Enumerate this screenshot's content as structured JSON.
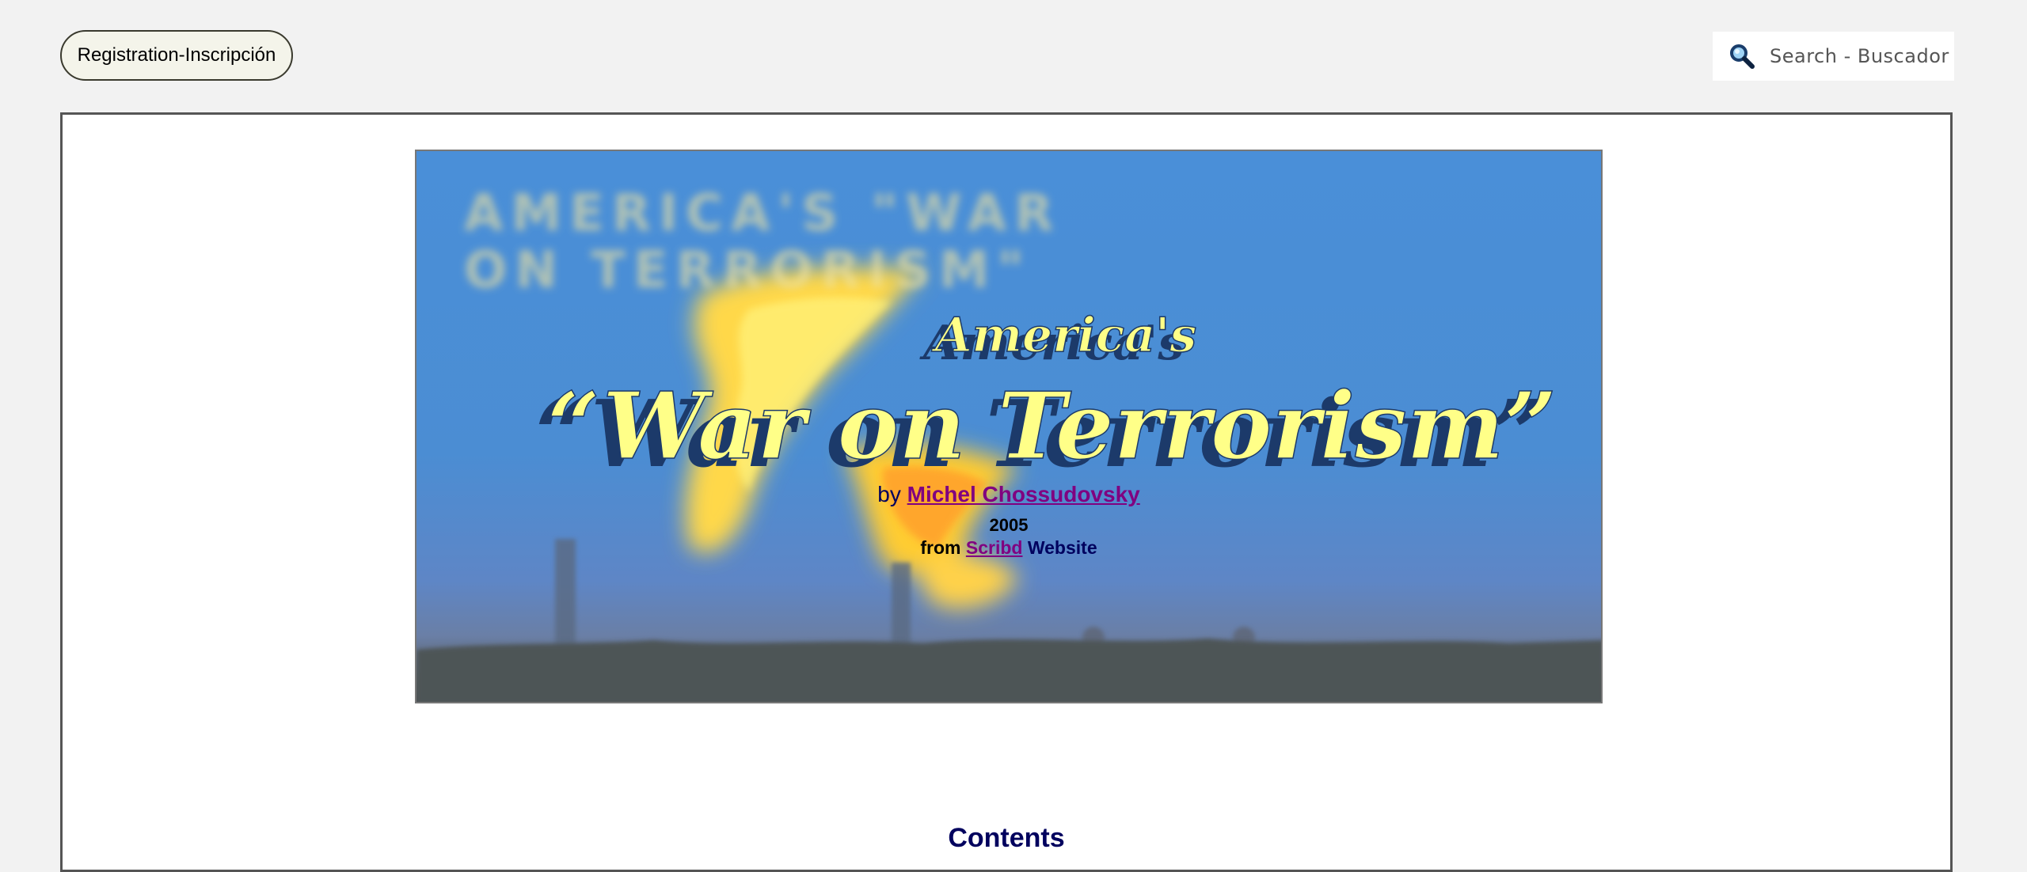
{
  "header": {
    "registration_label": "Registration-Inscripción",
    "search_label": "Search - Buscador",
    "search_icon": "magnifier-icon"
  },
  "banner": {
    "background_title": "AMERICA'S \"WAR ON TERRORISM\"",
    "title_small": "America's",
    "title_main": "“War on Terrorism”",
    "by_prefix": "by",
    "author": "Michel Chossudovsky",
    "year": "2005",
    "from_prefix": "from",
    "source": "Scribd",
    "source_suffix": "Website"
  },
  "main": {
    "contents_heading": "Contents"
  },
  "colors": {
    "page_bg": "#f2f2f2",
    "link_visited": "#800080",
    "navy_text": "#00005e",
    "title_yellow": "#ffff88"
  }
}
